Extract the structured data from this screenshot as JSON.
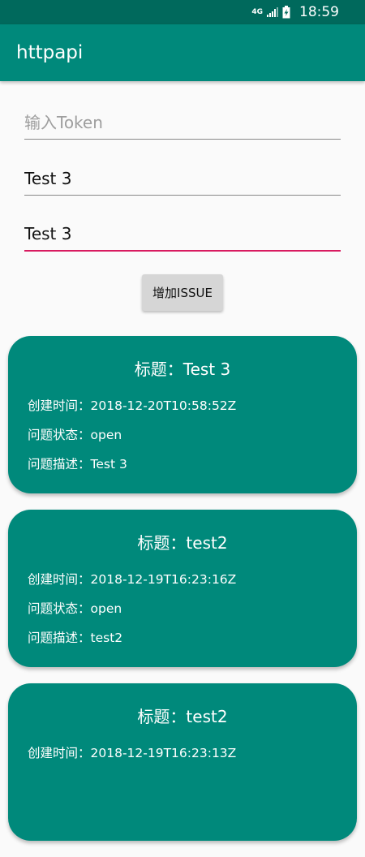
{
  "status_bar": {
    "network": "4G",
    "time": "18:59"
  },
  "app_bar": {
    "title": "httpapi"
  },
  "form": {
    "token_placeholder": "输入Token",
    "token_value": "",
    "title_value": "Test 3",
    "body_value": "Test 3",
    "add_button_label": "增加ISSUE"
  },
  "issues": [
    {
      "title": "标题：Test 3",
      "created": "创建时间：2018-12-20T10:58:52Z",
      "state": "问题状态：open",
      "desc": "问题描述：Test 3"
    },
    {
      "title": "标题：test2",
      "created": "创建时间：2018-12-19T16:23:16Z",
      "state": "问题状态：open",
      "desc": "问题描述：test2"
    },
    {
      "title": "标题：test2",
      "created": "创建时间：2018-12-19T16:23:13Z",
      "state": "",
      "desc": ""
    }
  ],
  "colors": {
    "primary": "#00897b",
    "primary_dark": "#00695c",
    "accent": "#d81b60"
  }
}
